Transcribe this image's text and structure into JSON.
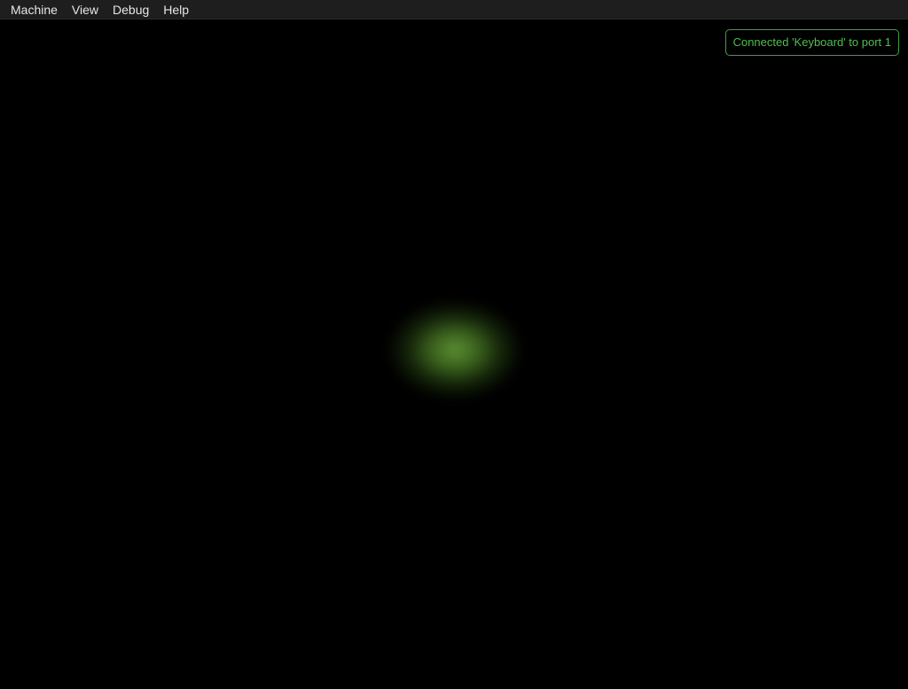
{
  "menubar": {
    "items": [
      {
        "label": "Machine"
      },
      {
        "label": "View"
      },
      {
        "label": "Debug"
      },
      {
        "label": "Help"
      }
    ]
  },
  "notification": {
    "text": "Connected 'Keyboard' to port 1",
    "color": "#4fbf4f"
  },
  "screen": {
    "background": "#000000",
    "glow_color": "#6aa83c"
  }
}
